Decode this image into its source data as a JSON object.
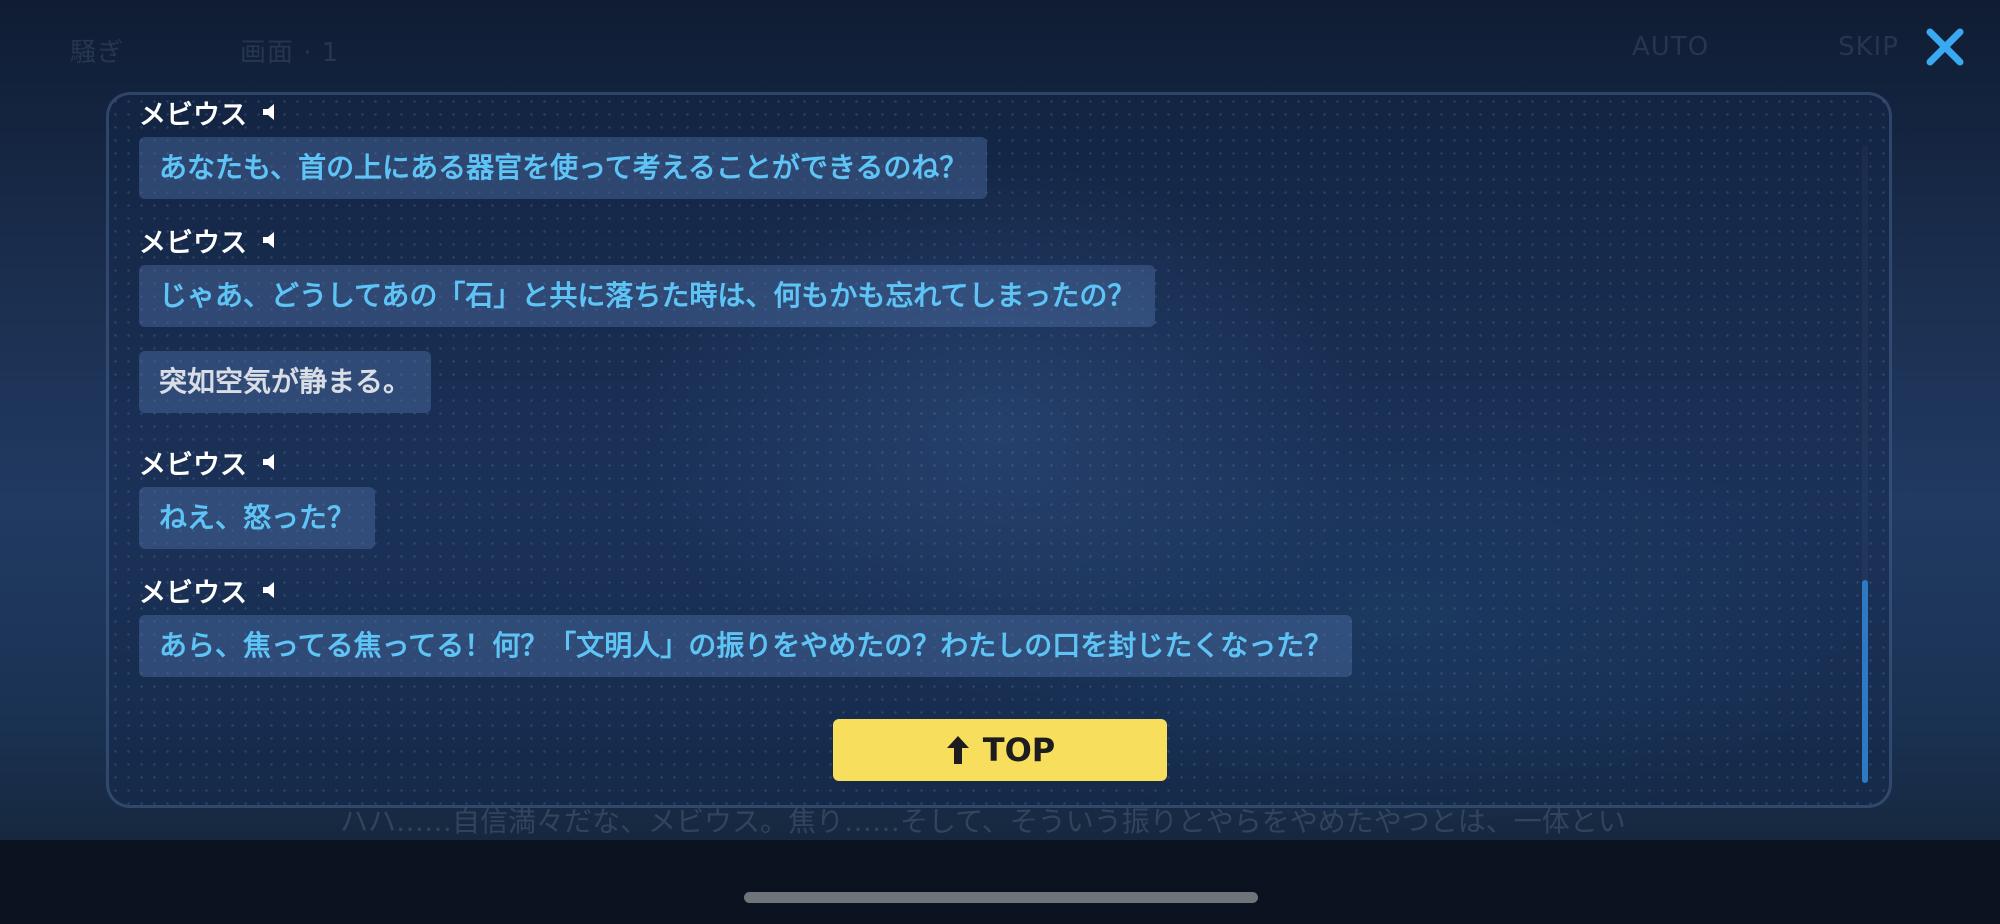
{
  "header": {
    "faded_left_1": "騒ぎ",
    "faded_left_2": "画面 · 1",
    "auto_label": "AUTO",
    "skip_label": "SKIP"
  },
  "close_icon": "close-icon",
  "background_subtitle": "ハハ……自信満々だな、メビウス。焦り……そして、そういう振りとやらをやめたやつとは、一体とい",
  "log": {
    "entries": [
      {
        "speaker": "メビウス",
        "text": "あなたも、首の上にある器官を使って考えることができるのね？"
      },
      {
        "speaker": "メビウス",
        "text": "じゃあ、どうしてあの「石」と共に落ちた時は、何もかも忘れてしまったの？"
      },
      {
        "speaker": "",
        "text": "突如空気が静まる。"
      },
      {
        "speaker": "メビウス",
        "text": "ねえ、怒った？"
      },
      {
        "speaker": "メビウス",
        "text": "あら、焦ってる焦ってる！何？「文明人」の振りをやめたの？わたしの口を封じたくなった？"
      }
    ],
    "top_button_label": "TOP"
  },
  "colors": {
    "accent_close": "#39a9f2",
    "dialogue_text": "#5ec4f5",
    "narration_text": "#d8dde6",
    "top_button_bg": "#f7de5c",
    "scrollbar_thumb": "#2f79c4"
  }
}
